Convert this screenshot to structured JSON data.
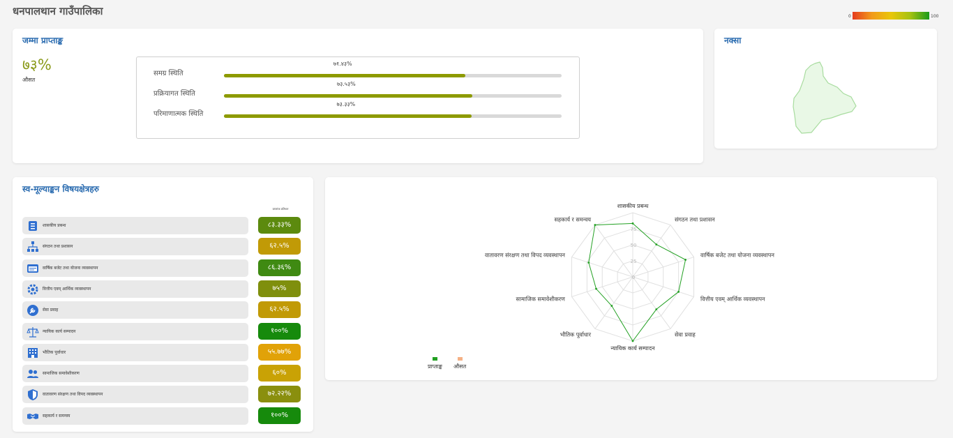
{
  "header": {
    "title": "धनपालथान गाउँपालिका"
  },
  "score_legend": {
    "min": "0",
    "max": "100",
    "low_color": "#e53b1f",
    "high_color": "#1a9a1a"
  },
  "total": {
    "title": "जम्मा प्राप्ताङ्क",
    "score": "७३%",
    "score_label": "औसत",
    "rows": [
      {
        "label": "समग्र स्थिति",
        "pct": "७१.४३%",
        "value": 71.43
      },
      {
        "label": "प्रक्रियागत स्थिति",
        "pct": "७३.५३%",
        "value": 73.53
      },
      {
        "label": "परिमाणात्मक स्थिति",
        "pct": "७३.३३%",
        "value": 73.33
      }
    ]
  },
  "map": {
    "title": "नक्सा",
    "fill_color": "#e9f8e6",
    "stroke_color": "#a8dc9f"
  },
  "subjects": {
    "title": "स्व-मूल्याङ्कन विषयक्षेत्रहरु",
    "pct_header": "प्राप्तांक प्रतिशत",
    "items": [
      {
        "label": "शासकीय प्रबन्ध",
        "value": "८३.३३%",
        "icon": "checklist-icon",
        "color": "#5c8a0e"
      },
      {
        "label": "संगठन तथा प्रशासन",
        "value": "६२.५%",
        "icon": "org-chart-icon",
        "color": "#c19a06"
      },
      {
        "label": "वार्षिक बजेट तथा योजना व्यवस्थापन",
        "value": "८६.३६%",
        "icon": "budget-icon",
        "color": "#3f8a12"
      },
      {
        "label": "वित्तीय एवम् आर्थिक व्यवस्थापन",
        "value": "७५%",
        "icon": "gear-icon",
        "color": "#7f8f0d"
      },
      {
        "label": "सेवा प्रवाह",
        "value": "६२.५%",
        "icon": "wrench-icon",
        "color": "#c19a06"
      },
      {
        "label": "न्यायिक कार्य सम्पादन",
        "value": "१००%",
        "icon": "scales-icon",
        "color": "#168a0c"
      },
      {
        "label": "भौतिक पूर्वाधार",
        "value": "५५.७७%",
        "icon": "building-icon",
        "color": "#e1a208"
      },
      {
        "label": "सामाजिक समावेशीकरण",
        "value": "६०%",
        "icon": "people-icon",
        "color": "#c9a205"
      },
      {
        "label": "वातावरण संरक्षण तथा विपद व्यवस्थापन",
        "value": "७२.२२%",
        "icon": "shield-icon",
        "color": "#8a8f0e"
      },
      {
        "label": "सहकार्य र समन्वय",
        "value": "१००%",
        "icon": "handshake-icon",
        "color": "#168a0c"
      }
    ]
  },
  "chart_data": {
    "type": "radar",
    "axes": [
      "शासकीय प्रबन्ध",
      "संगठन तथा प्रशासन",
      "वार्षिक बजेट तथा योजना व्यवस्थापन",
      "वित्तीय एवम् आर्थिक व्यवस्थापन",
      "सेवा प्रवाह",
      "न्यायिक कार्य सम्पादन",
      "भौतिक पूर्वाधार",
      "सामाजिक समावेशीकरण",
      "वातावरण संरक्षण तथा विपद व्यवस्थापन",
      "सहकार्य र समन्वय"
    ],
    "rlim": [
      0,
      100
    ],
    "ticks": [
      0,
      25,
      50,
      75
    ],
    "series": [
      {
        "name": "प्राप्ताङ्क",
        "color": "#22a022",
        "values": [
          83.33,
          62.5,
          86.36,
          75,
          62.5,
          100,
          55.77,
          60,
          72.22,
          100
        ]
      },
      {
        "name": "औसत",
        "color": "#f5b185",
        "values": []
      }
    ],
    "legend": "bottom-left",
    "grid": true
  }
}
